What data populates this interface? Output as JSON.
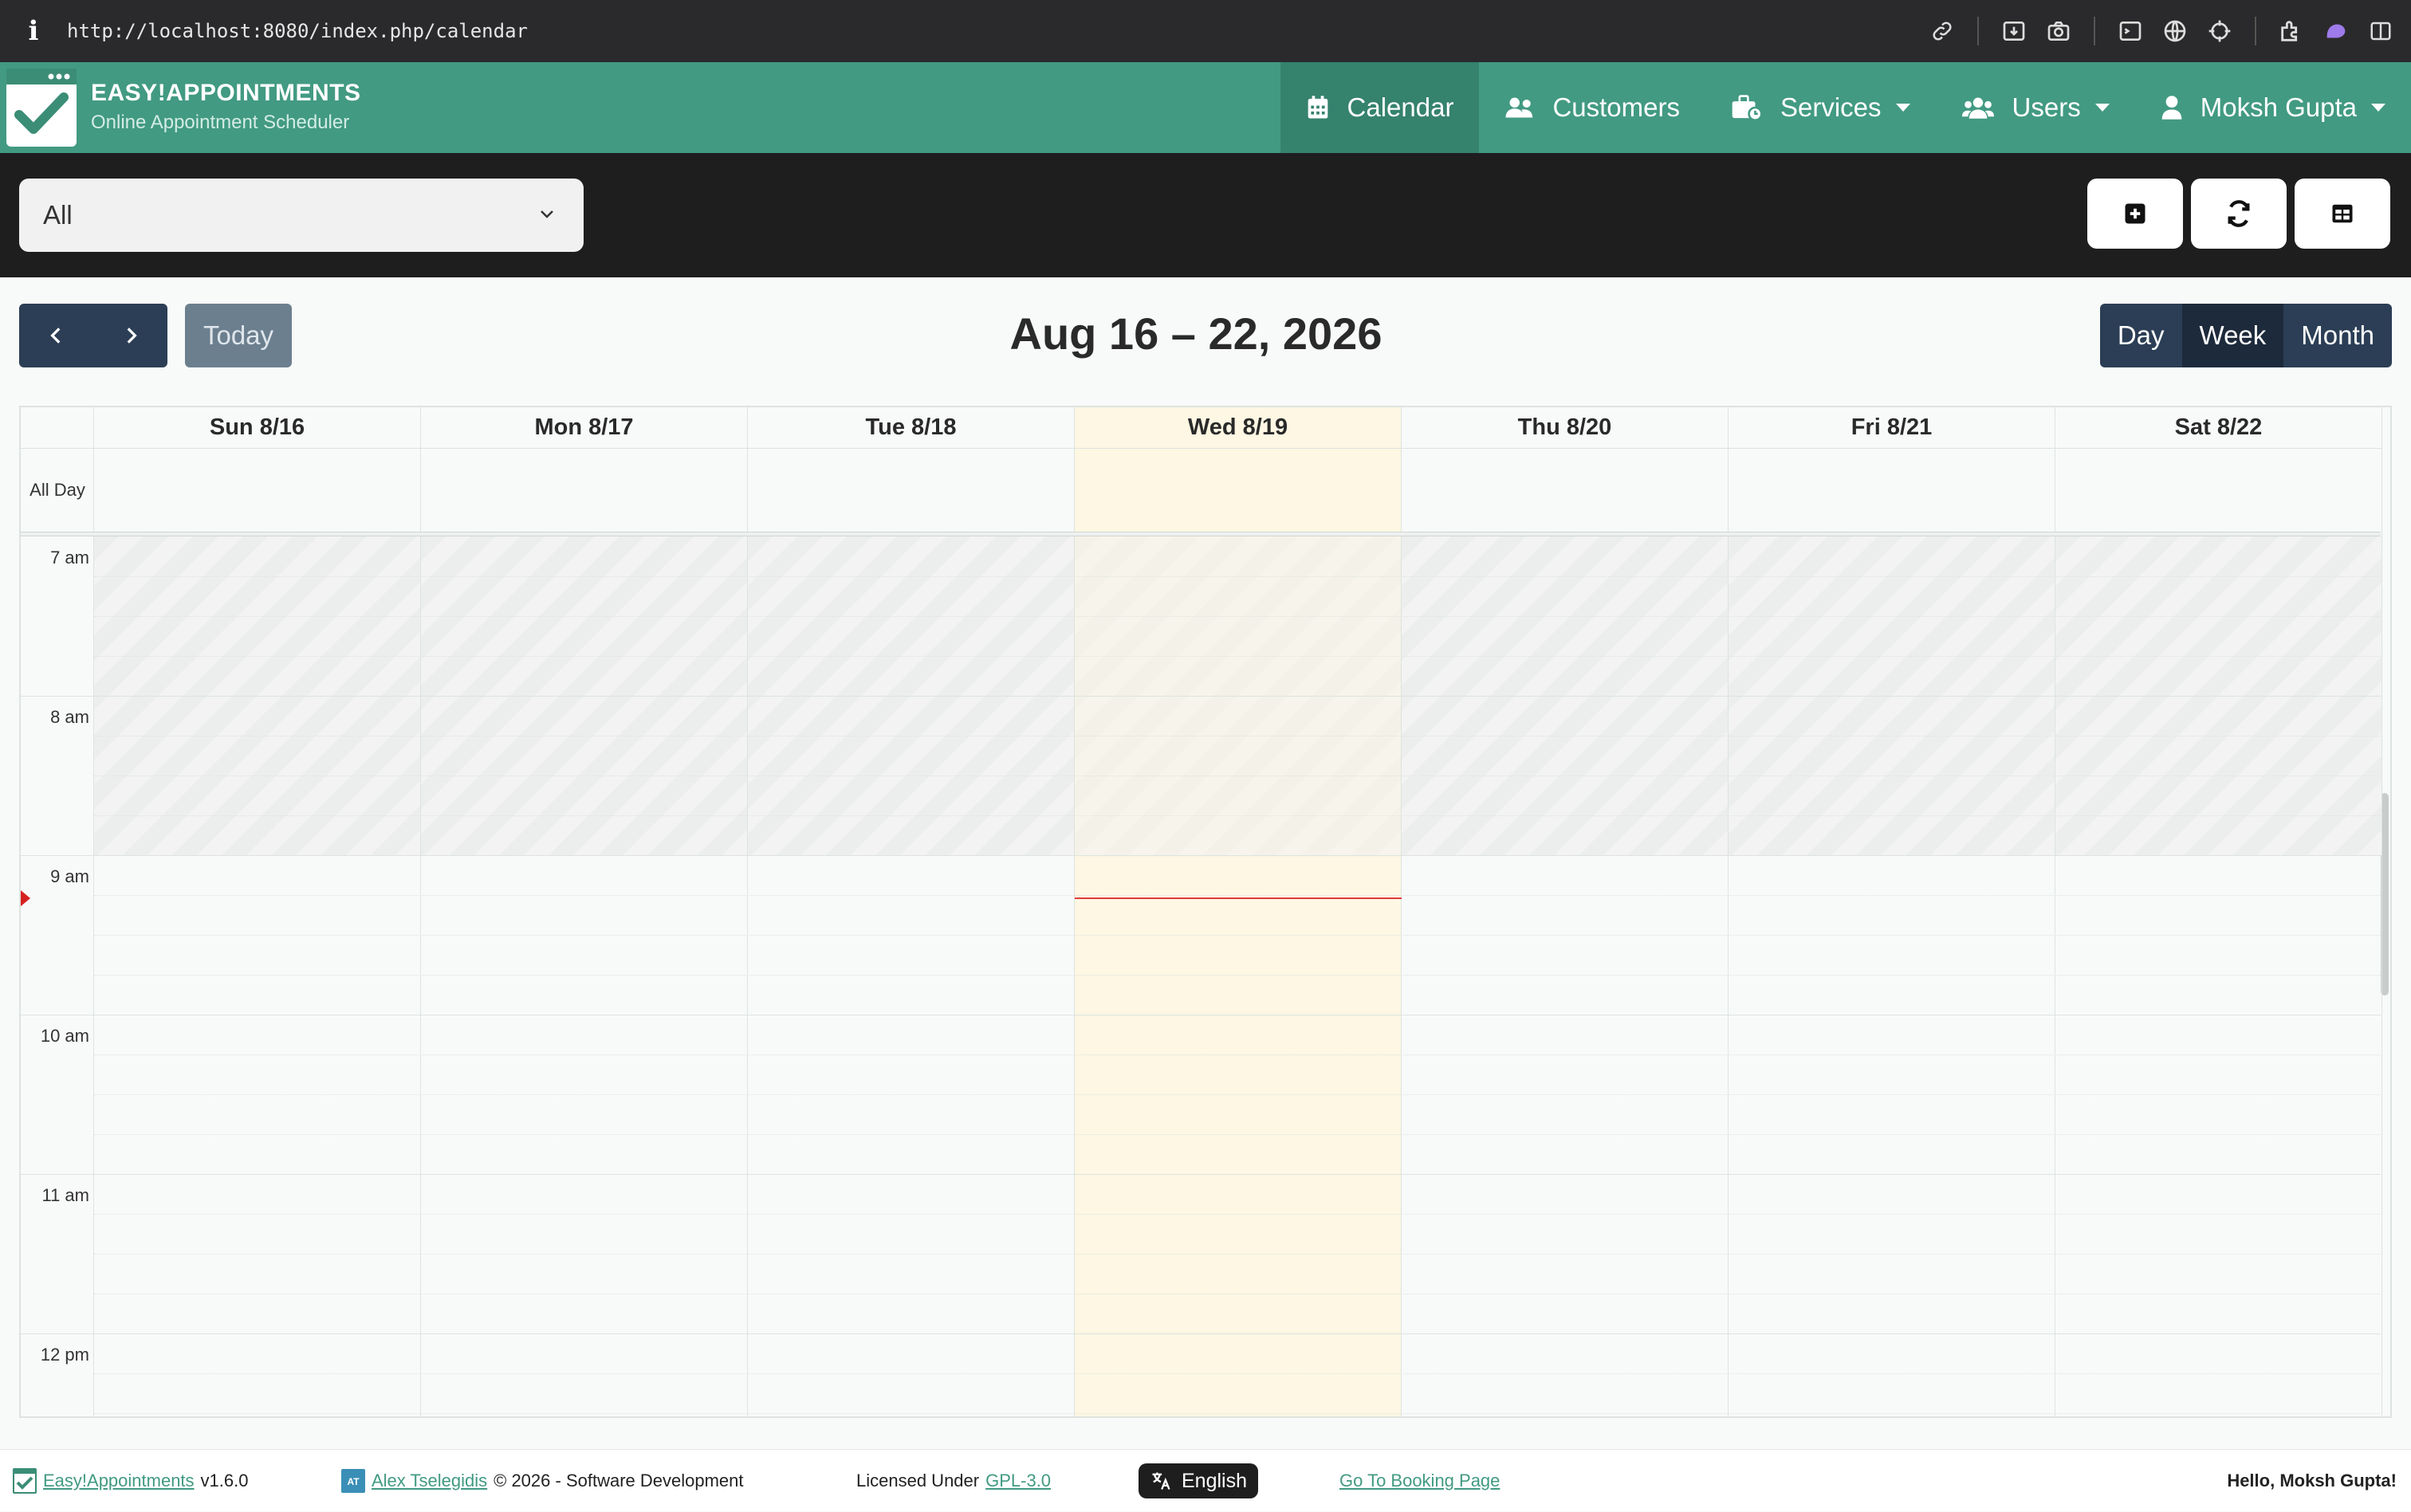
{
  "browser": {
    "url": "http://localhost:8080/index.php/calendar"
  },
  "header": {
    "brand_title": "EASY!APPOINTMENTS",
    "brand_subtitle": "Online Appointment Scheduler",
    "nav": [
      {
        "label": "Calendar",
        "icon": "calendar-icon",
        "active": true
      },
      {
        "label": "Customers",
        "icon": "customers-icon"
      },
      {
        "label": "Services",
        "icon": "services-icon",
        "dropdown": true
      },
      {
        "label": "Users",
        "icon": "users-icon",
        "dropdown": true
      },
      {
        "label": "Moksh Gupta",
        "icon": "user-icon",
        "dropdown": true
      }
    ]
  },
  "toolbar": {
    "filter_value": "All"
  },
  "calendar": {
    "title": "Aug 16 – 22, 2026",
    "today_label": "Today",
    "views": [
      "Day",
      "Week",
      "Month"
    ],
    "active_view": "Week",
    "all_day_label": "All Day",
    "days": [
      "Sun 8/16",
      "Mon 8/17",
      "Tue 8/18",
      "Wed 8/19",
      "Thu 8/20",
      "Fri 8/21",
      "Sat 8/22"
    ],
    "today_index": 3,
    "hours": [
      "7 am",
      "8 am",
      "9 am",
      "10 am",
      "11 am",
      "12 pm"
    ]
  },
  "footer": {
    "app_link": "Easy!Appointments",
    "version": "v1.6.0",
    "author_link": "Alex Tselegidis",
    "copyright": "© 2026 - Software Development",
    "license_prefix": "Licensed Under",
    "license_link": "GPL-3.0",
    "language": "English",
    "booking_link": "Go To Booking Page",
    "greeting": "Hello, Moksh Gupta!"
  },
  "colors": {
    "brand": "#429a82",
    "nav_dark": "#2b3e55",
    "today_col": "#fdf7e3",
    "now_line": "#e23c3c"
  }
}
